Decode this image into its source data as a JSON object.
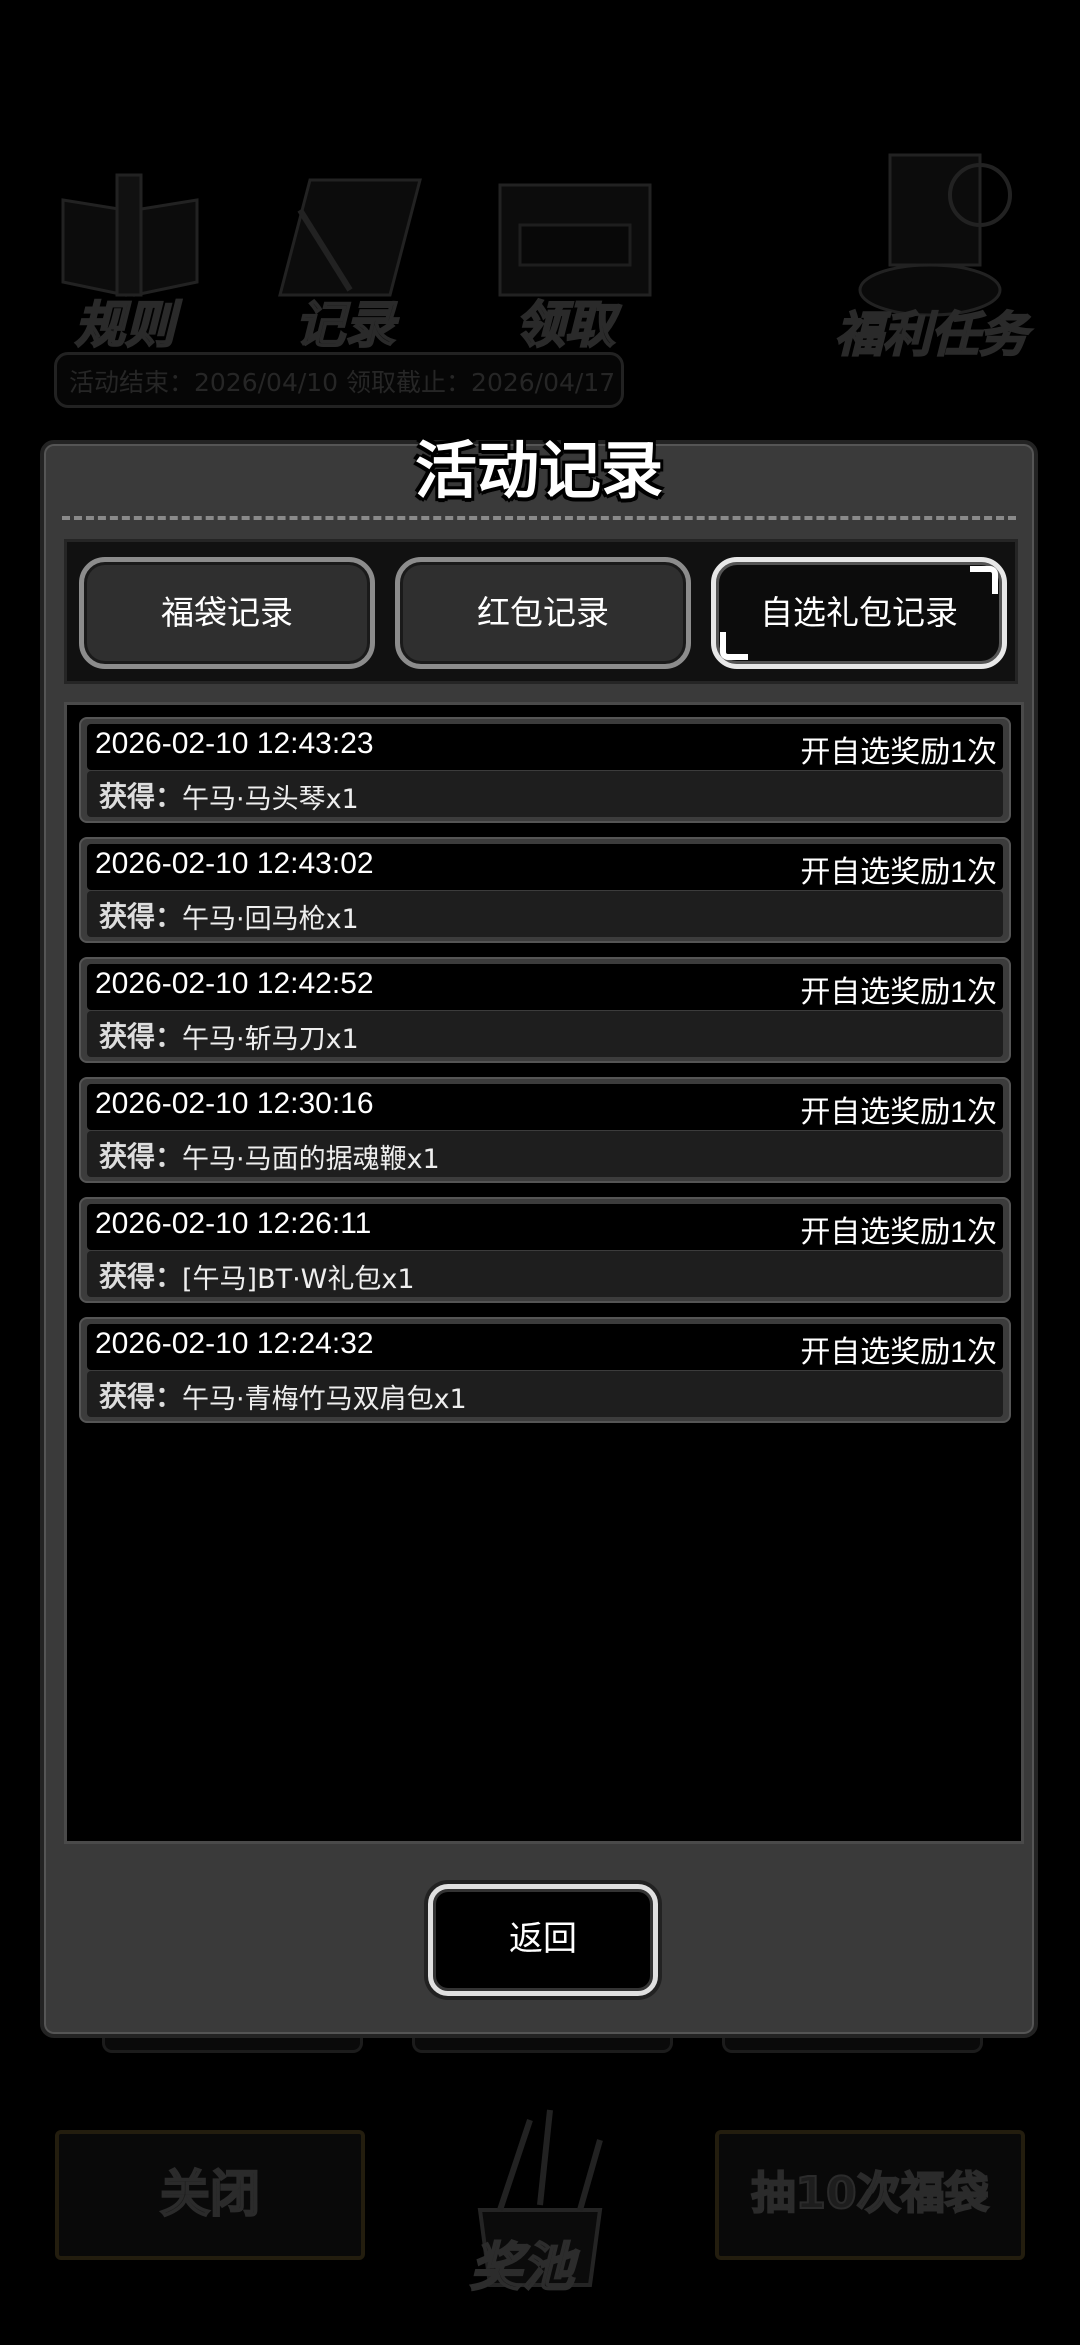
{
  "background": {
    "top_icons": [
      {
        "name": "rules",
        "label": "规则"
      },
      {
        "name": "records",
        "label": "记录"
      },
      {
        "name": "claim",
        "label": "领取"
      },
      {
        "name": "welfare",
        "label": "福利任务"
      }
    ],
    "date_strip": "活动结束：2026/04/10   领取截止：2026/04/17",
    "close_label": "关闭",
    "pool_label": "奖池",
    "draw_label": "抽10次福袋"
  },
  "modal": {
    "title": "活动记录",
    "tabs": [
      {
        "label": "福袋记录",
        "active": false
      },
      {
        "label": "红包记录",
        "active": false
      },
      {
        "label": "自选礼包记录",
        "active": true
      }
    ],
    "get_label": "获得：",
    "records": [
      {
        "time": "2026-02-10 12:43:23",
        "tag": "开自选奖励1次",
        "item": "午马·马头琴x1"
      },
      {
        "time": "2026-02-10 12:43:02",
        "tag": "开自选奖励1次",
        "item": "午马·回马枪x1"
      },
      {
        "time": "2026-02-10 12:42:52",
        "tag": "开自选奖励1次",
        "item": "午马·斩马刀x1"
      },
      {
        "time": "2026-02-10 12:30:16",
        "tag": "开自选奖励1次",
        "item": "午马·马面的据魂鞭x1"
      },
      {
        "time": "2026-02-10 12:26:11",
        "tag": "开自选奖励1次",
        "item": "[午马]BT·W礼包x1"
      },
      {
        "time": "2026-02-10 12:24:32",
        "tag": "开自选奖励1次",
        "item": "午马·青梅竹马双肩包x1"
      }
    ],
    "back_label": "返回"
  }
}
